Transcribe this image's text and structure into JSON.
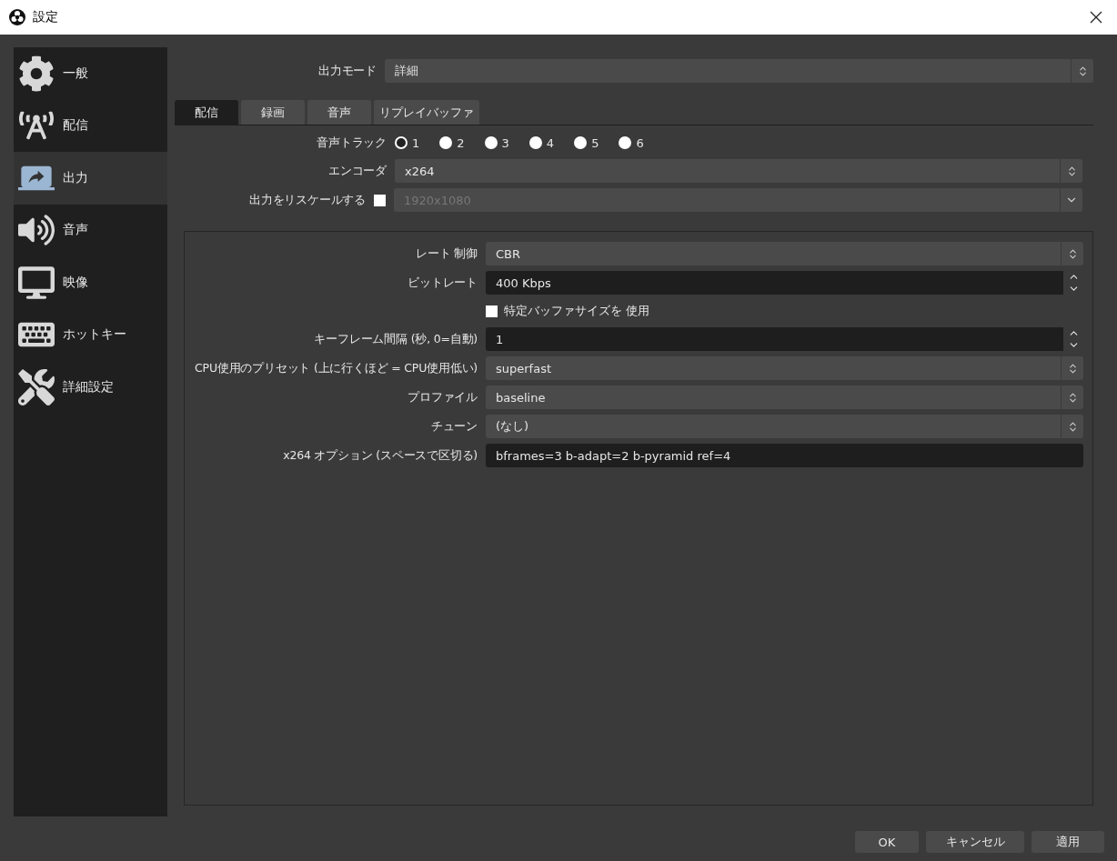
{
  "window": {
    "title": "設定"
  },
  "sidebar": {
    "items": [
      {
        "label": "一般",
        "selected": false
      },
      {
        "label": "配信",
        "selected": false
      },
      {
        "label": "出力",
        "selected": true
      },
      {
        "label": "音声",
        "selected": false
      },
      {
        "label": "映像",
        "selected": false
      },
      {
        "label": "ホットキー",
        "selected": false
      },
      {
        "label": "詳細設定",
        "selected": false
      }
    ]
  },
  "output_mode": {
    "label": "出力モード",
    "value": "詳細"
  },
  "tabs": [
    {
      "label": "配信",
      "selected": true
    },
    {
      "label": "録画",
      "selected": false
    },
    {
      "label": "音声",
      "selected": false
    },
    {
      "label": "リプレイバッファ",
      "selected": false
    }
  ],
  "audio_track": {
    "label": "音声トラック",
    "options": [
      {
        "label": "1",
        "selected": true
      },
      {
        "label": "2",
        "selected": false
      },
      {
        "label": "3",
        "selected": false
      },
      {
        "label": "4",
        "selected": false
      },
      {
        "label": "5",
        "selected": false
      },
      {
        "label": "6",
        "selected": false
      }
    ]
  },
  "encoder": {
    "label": "エンコーダ",
    "value": "x264"
  },
  "rescale": {
    "label": "出力をリスケールする",
    "checked": false,
    "value": "1920x1080"
  },
  "settings": [
    {
      "kind": "select",
      "label": "レート 制御",
      "value": "CBR"
    },
    {
      "kind": "spin",
      "label": "ビットレート",
      "value": "400 Kbps"
    },
    {
      "kind": "checkbox",
      "label": "特定バッファサイズを 使用",
      "checked": false
    },
    {
      "kind": "spin",
      "label": "キーフレーム間隔 (秒, 0=自動)",
      "value": "1"
    },
    {
      "kind": "select",
      "label": "CPU使用のプリセット (上に行くほど = CPU使用低い)",
      "value": "superfast"
    },
    {
      "kind": "select",
      "label": "プロファイル",
      "value": "baseline"
    },
    {
      "kind": "select",
      "label": "チューン",
      "value": "(なし)"
    },
    {
      "kind": "text",
      "label": "x264 オプション (スペースで区切る)",
      "value": "bframes=3 b-adapt=2 b-pyramid ref=4"
    }
  ],
  "buttons": [
    {
      "label": "OK"
    },
    {
      "label": "キャンセル"
    },
    {
      "label": "適用"
    }
  ]
}
